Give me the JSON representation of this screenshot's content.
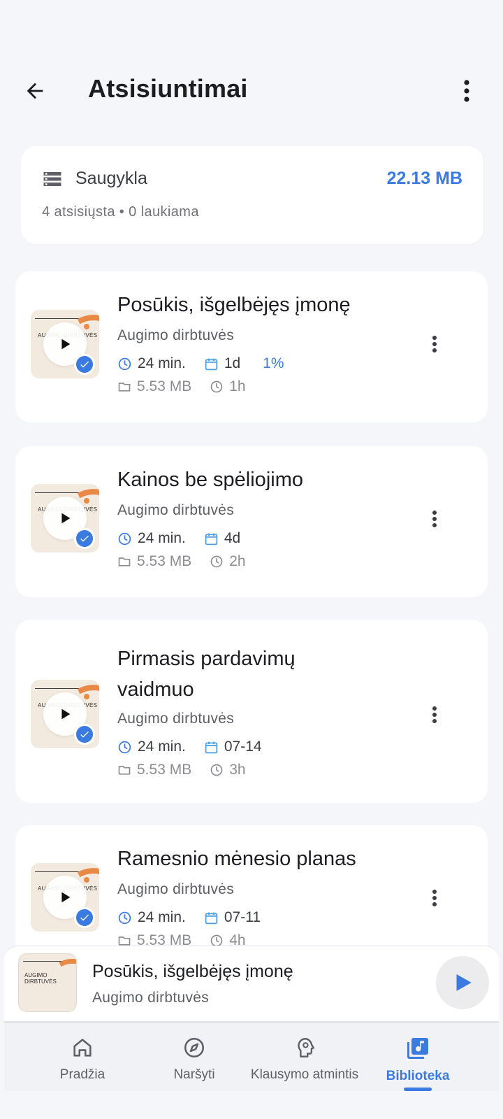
{
  "header": {
    "title": "Atsisiuntimai"
  },
  "storage": {
    "label": "Saugykla",
    "size": "22.13 MB",
    "summary": "4 atsisiųsta • 0 laukiama"
  },
  "cover_text": "AUGIMO DIRBTUVĖS",
  "episodes": [
    {
      "title": "Posūkis, išgelbėjęs įmonę",
      "author": "Augimo dirbtuvės",
      "duration": "24 min.",
      "date": "1d",
      "progress": "1%",
      "size": "5.53 MB",
      "ago": "1h"
    },
    {
      "title": "Kainos be spėliojimo",
      "author": "Augimo dirbtuvės",
      "duration": "24 min.",
      "date": "4d",
      "progress": "",
      "size": "5.53 MB",
      "ago": "2h"
    },
    {
      "title": "Pirmasis pardavimų vaidmuo",
      "author": "Augimo dirbtuvės",
      "duration": "24 min.",
      "date": "07-14",
      "progress": "",
      "size": "5.53 MB",
      "ago": "3h"
    },
    {
      "title": "Ramesnio mėnesio planas",
      "author": "Augimo dirbtuvės",
      "duration": "24 min.",
      "date": "07-11",
      "progress": "",
      "size": "5.53 MB",
      "ago": "4h"
    }
  ],
  "player": {
    "title": "Posūkis, išgelbėjęs įmonę",
    "author": "Augimo dirbtuvės",
    "cover_text": "AUGIMO DIRBTUVĖS"
  },
  "nav": {
    "items": [
      {
        "label": "Pradžia",
        "icon": "home-icon"
      },
      {
        "label": "Naršyti",
        "icon": "compass-icon"
      },
      {
        "label": "Klausymo atmintis",
        "icon": "head-brain-icon"
      },
      {
        "label": "Biblioteka",
        "icon": "library-music-icon"
      }
    ],
    "active": "Biblioteka"
  },
  "colors": {
    "accent": "#3b7ae0",
    "cover_orange": "#e88a45",
    "background": "#f5f6fa"
  }
}
